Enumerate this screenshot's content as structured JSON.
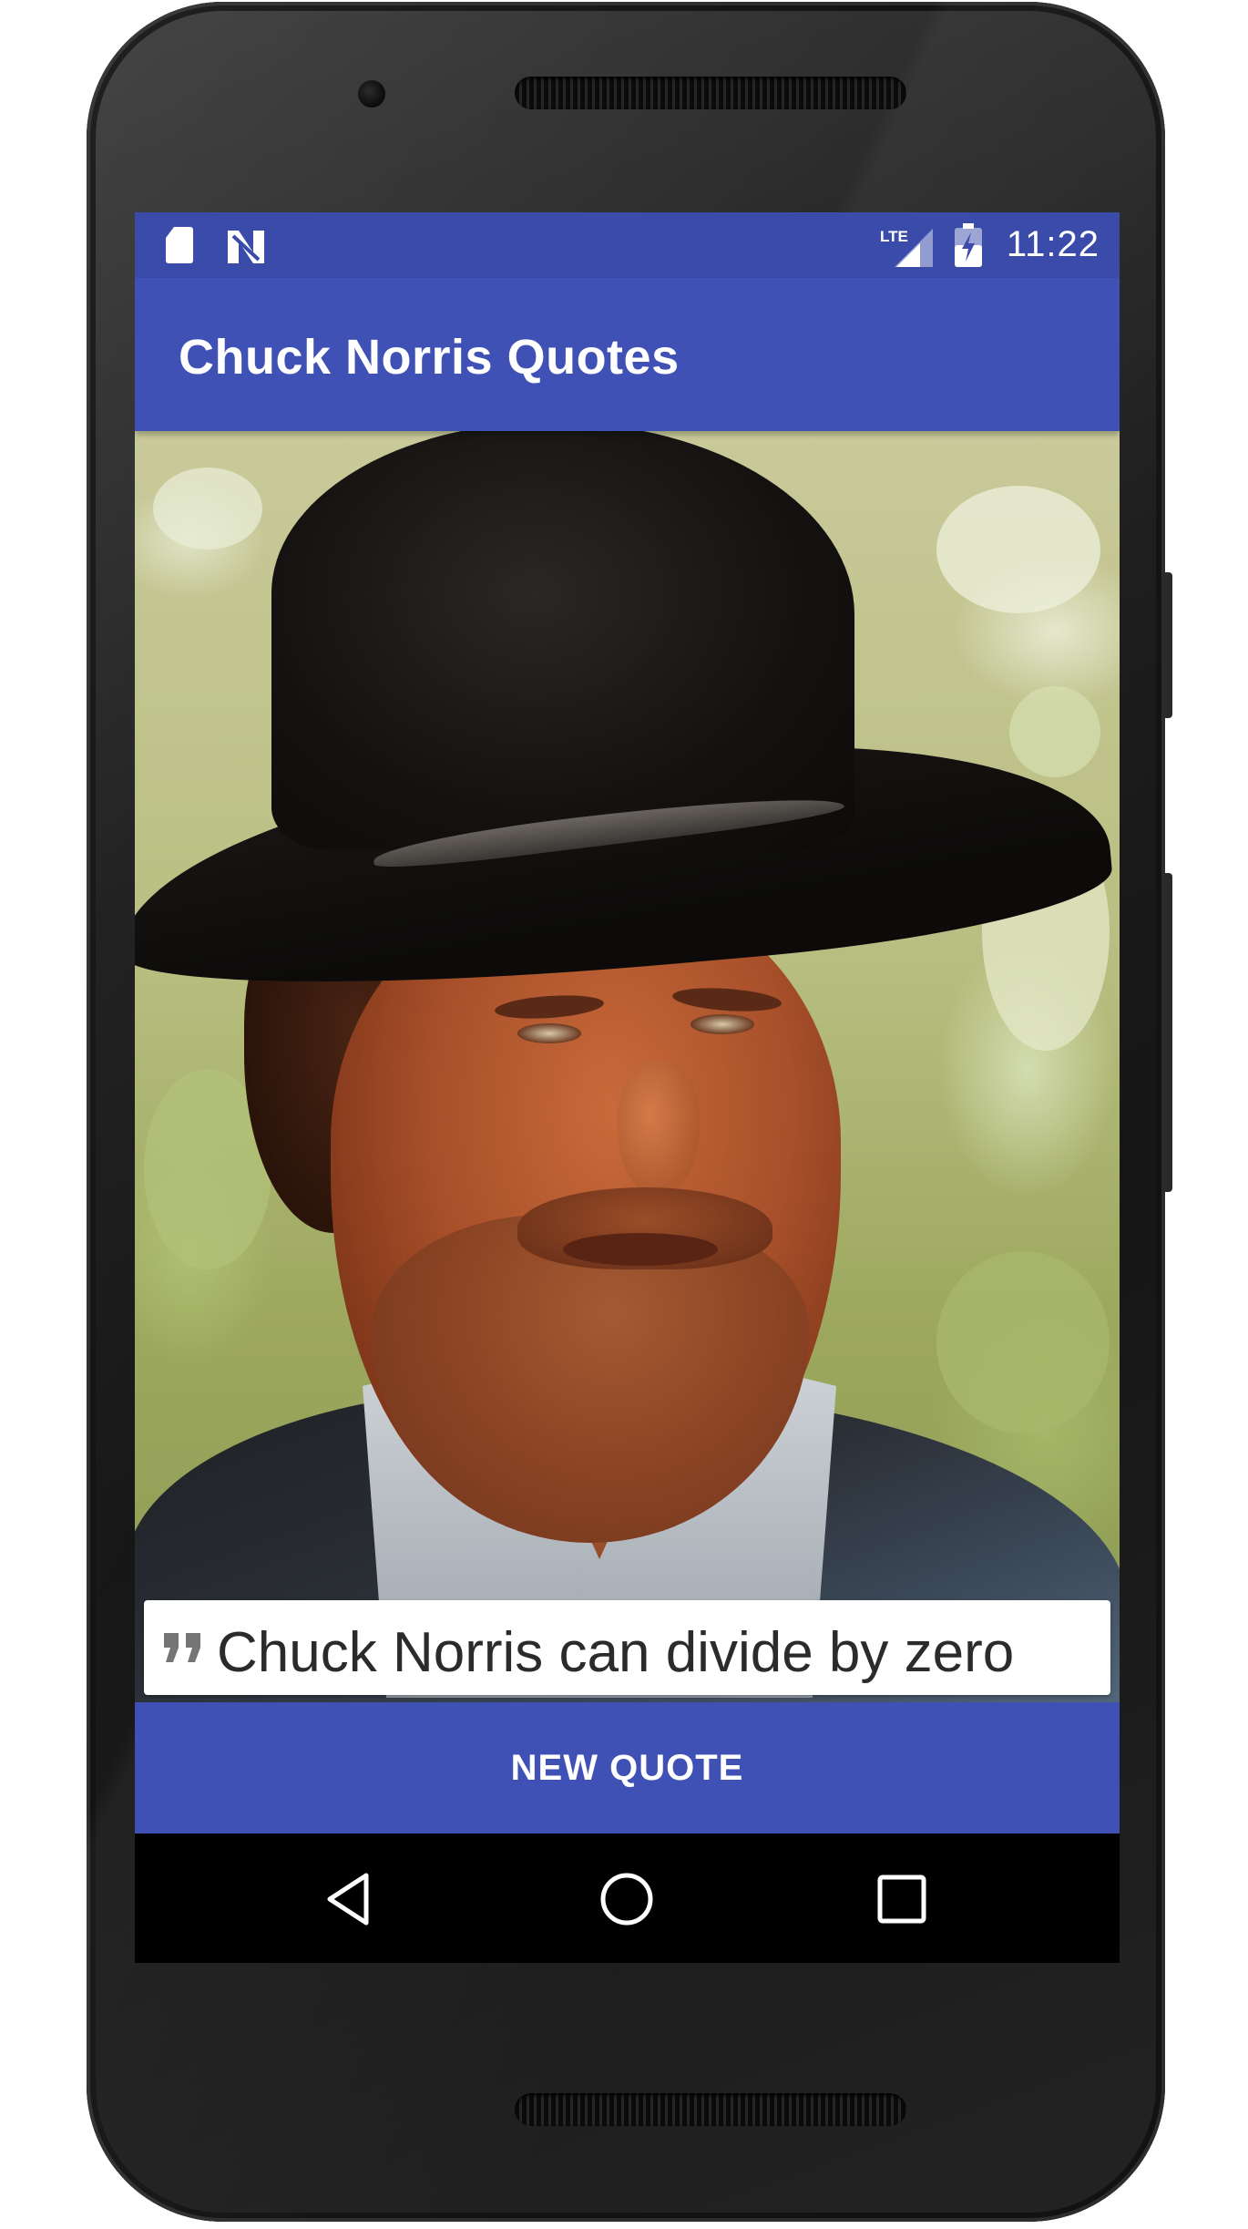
{
  "status_bar": {
    "time": "11:22",
    "network_label": "LTE",
    "icons": [
      "sd-card-icon",
      "n-notification-icon",
      "lte-signal-icon",
      "battery-charging-icon"
    ]
  },
  "app_bar": {
    "title": "Chuck Norris Quotes"
  },
  "photo": {
    "subject_icon": "chuck-norris-photo"
  },
  "quote": {
    "icon": "format-quote-icon",
    "text": "Chuck Norris can divide by zero"
  },
  "actions": {
    "new_quote_label": "NEW QUOTE"
  },
  "nav_bar": {
    "icons": [
      "back-icon",
      "home-icon",
      "recents-icon"
    ]
  },
  "colors": {
    "primary": "#3f51b5",
    "primary_dark": "#3a4baa",
    "nav_background": "#000000",
    "quote_text": "#2b2b2b"
  }
}
